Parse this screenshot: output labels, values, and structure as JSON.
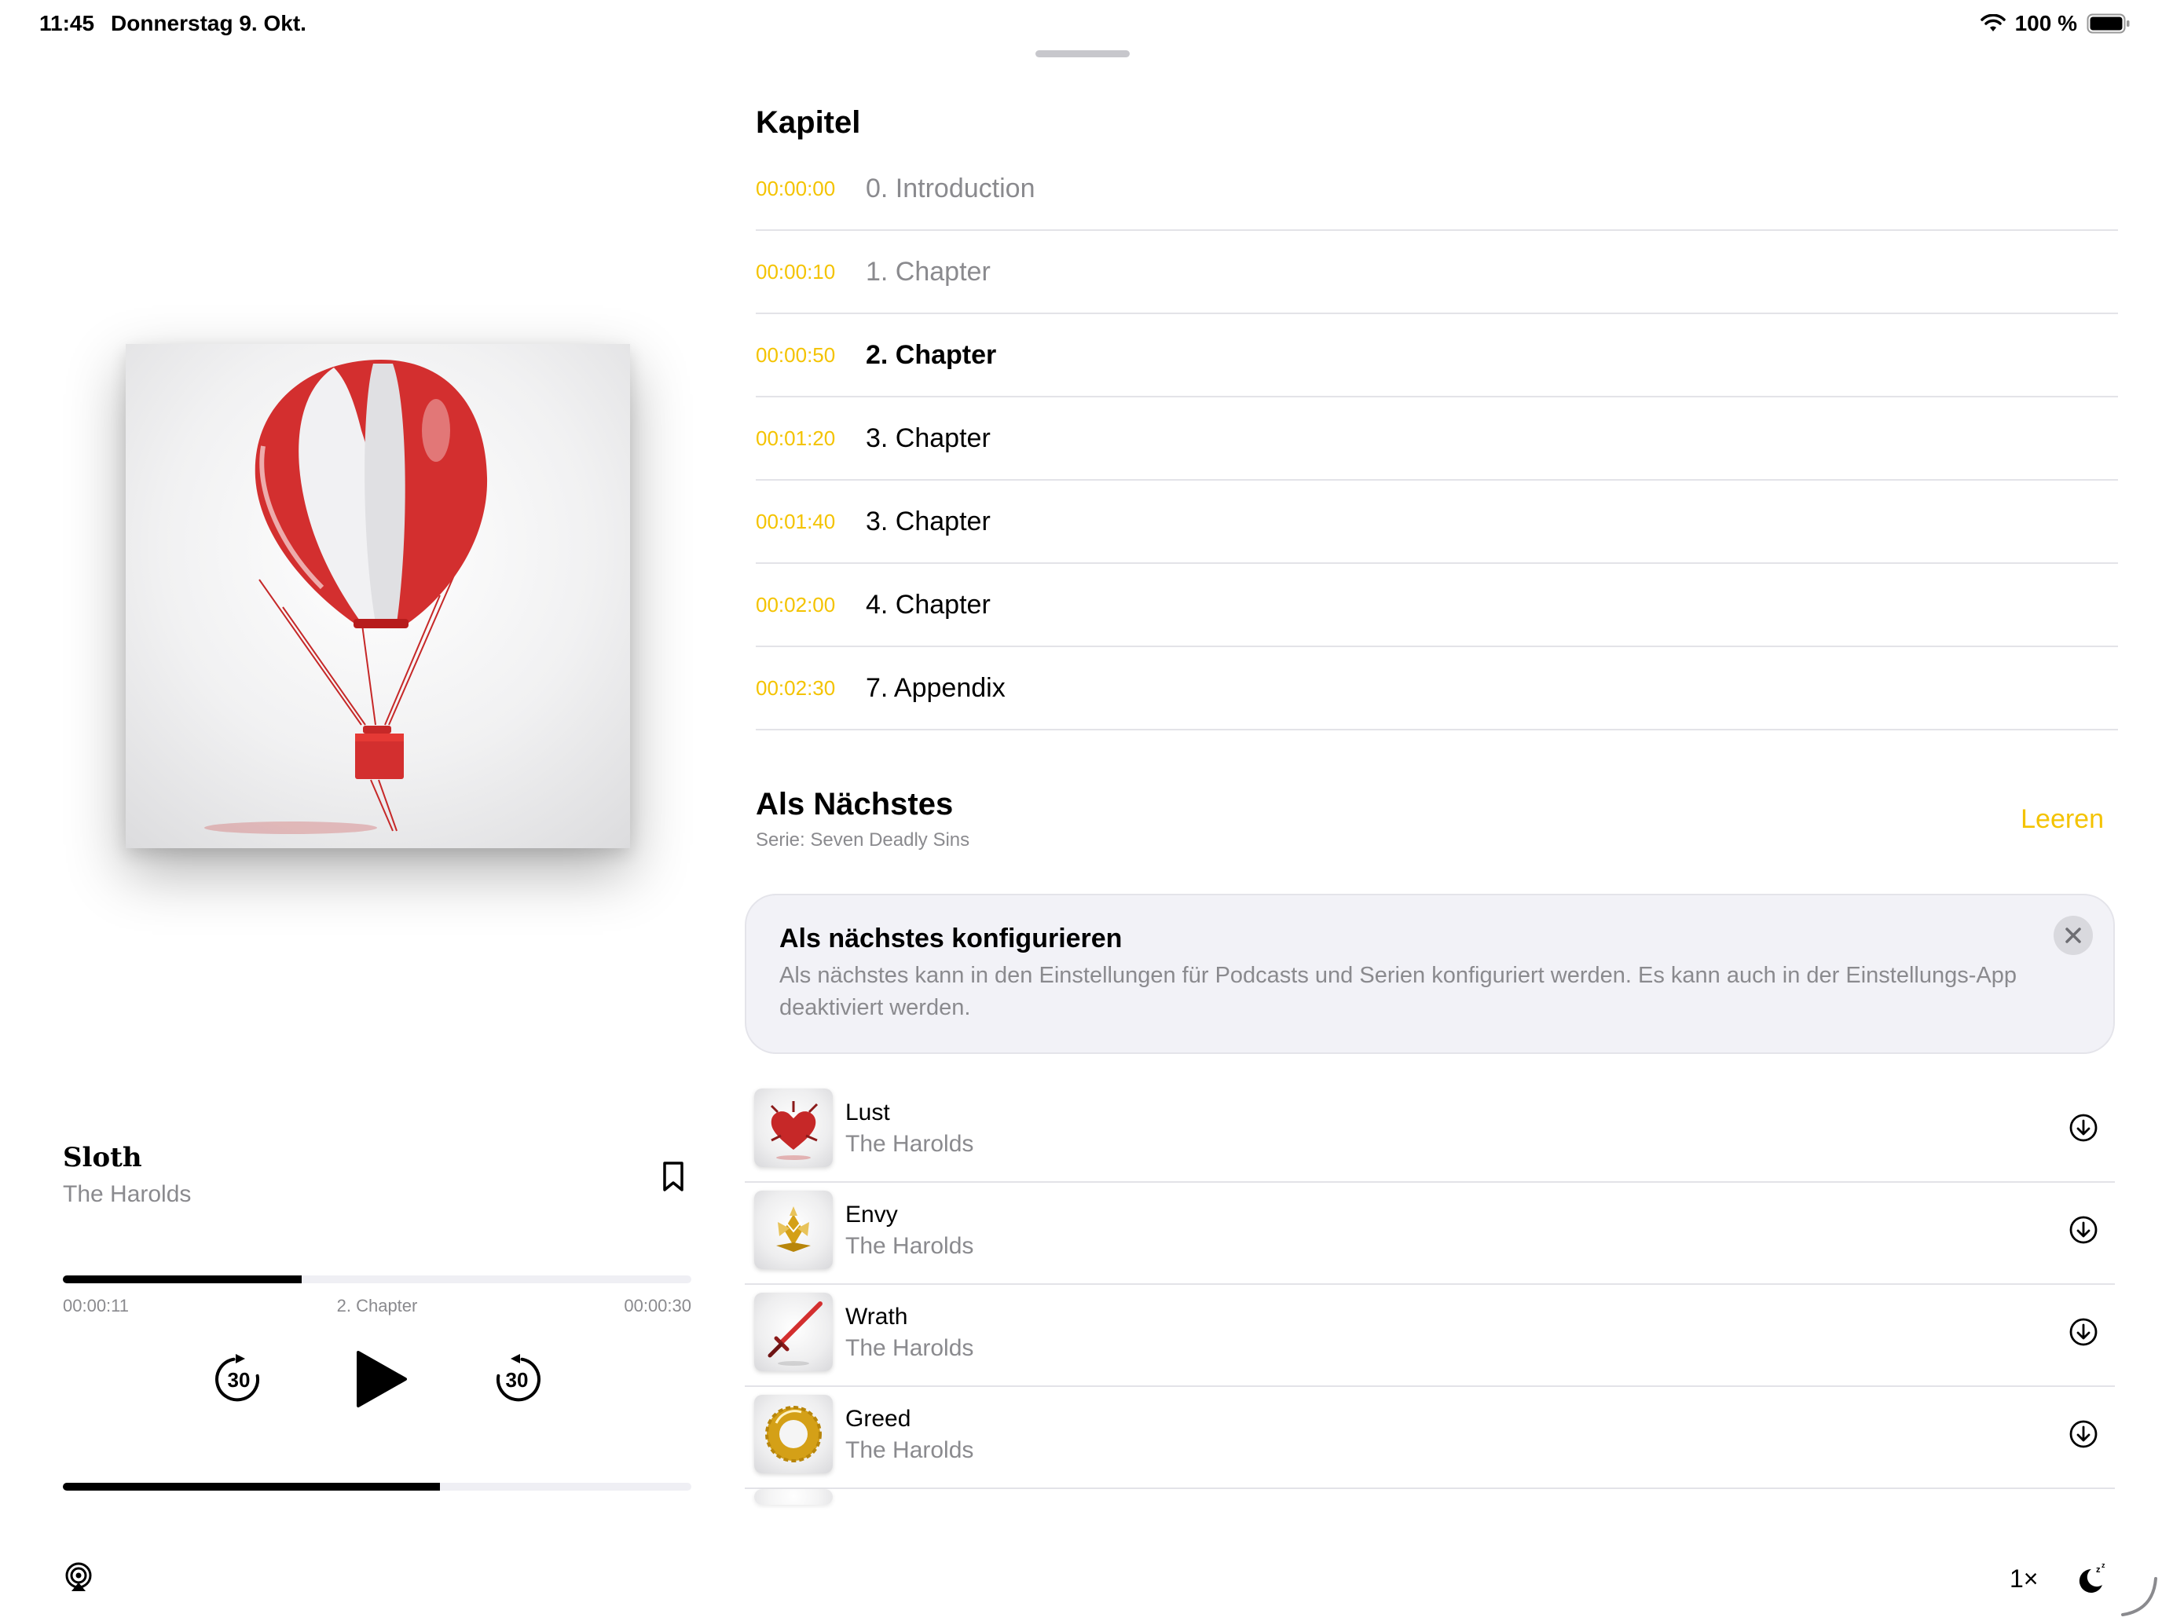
{
  "status_bar": {
    "time": "11:45",
    "date": "Donnerstag 9. Okt.",
    "battery_text": "100 %",
    "icons": [
      "wifi-icon",
      "battery-icon"
    ]
  },
  "now_playing": {
    "title": "Sloth",
    "artist": "The Harolds",
    "elapsed": "00:00:11",
    "current_chapter": "2. Chapter",
    "remaining": "00:00:30",
    "progress_fraction": 0.38,
    "volume_fraction": 0.6,
    "skip_back_label": "30",
    "skip_forward_label": "30",
    "speed": "1×"
  },
  "chapters": {
    "heading": "Kapitel",
    "items": [
      {
        "time": "00:00:00",
        "name": "0. Introduction",
        "state": "played"
      },
      {
        "time": "00:00:10",
        "name": "1. Chapter",
        "state": "played"
      },
      {
        "time": "00:00:50",
        "name": "2. Chapter",
        "state": "current"
      },
      {
        "time": "00:01:20",
        "name": "3. Chapter",
        "state": "upcoming"
      },
      {
        "time": "00:01:40",
        "name": "3. Chapter",
        "state": "upcoming"
      },
      {
        "time": "00:02:00",
        "name": "4. Chapter",
        "state": "upcoming"
      },
      {
        "time": "00:02:30",
        "name": "7. Appendix",
        "state": "upcoming"
      }
    ]
  },
  "up_next": {
    "heading": "Als Nächstes",
    "subtitle": "Serie: Seven Deadly Sins",
    "clear_label": "Leeren",
    "config_card": {
      "title": "Als nächstes konfigurieren",
      "text": "Als nächstes kann in den Einstellungen für Podcasts und Serien konfiguriert werden. Es kann auch in der Einstellungs-App deaktiviert werden."
    },
    "items": [
      {
        "title": "Lust",
        "artist": "The Harolds",
        "art": "heart-art"
      },
      {
        "title": "Envy",
        "artist": "The Harolds",
        "art": "gold-shards-art"
      },
      {
        "title": "Wrath",
        "artist": "The Harolds",
        "art": "sword-art"
      },
      {
        "title": "Greed",
        "artist": "The Harolds",
        "art": "gold-ring-art"
      }
    ]
  },
  "colors": {
    "accent": "#f4c300",
    "secondary_text": "#8a8a8e",
    "separator": "#e3e3e8",
    "card_background": "#f2f2f7"
  }
}
